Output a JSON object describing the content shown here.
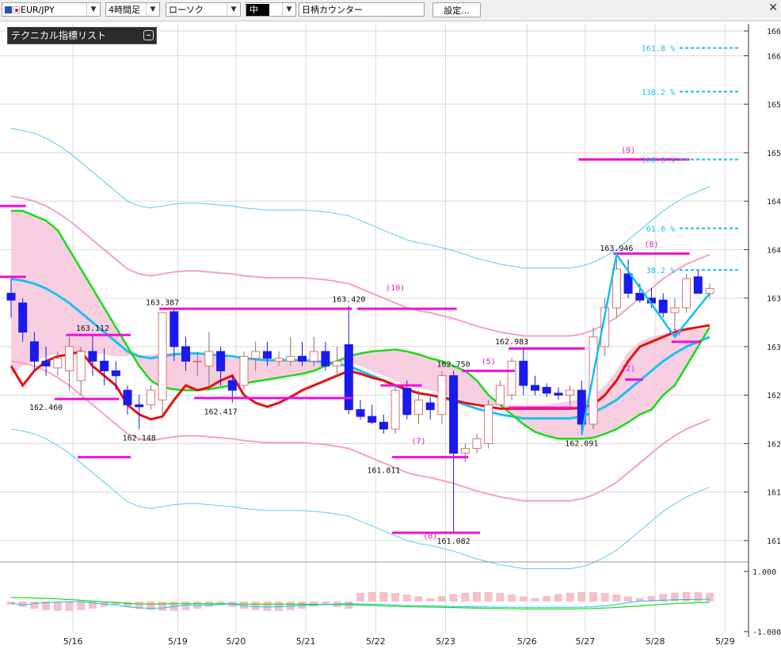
{
  "toolbar": {
    "symbol": "EUR/JPY",
    "timeframe": "4時間足",
    "chart_style": "ローソク",
    "size": "中",
    "counter": "日柄カウンター",
    "settings_label": "設定...",
    "flag_eu_color": "#2a4fb8",
    "flag_jp_color": "#d11a1a"
  },
  "indicator_panel": {
    "title": "テクニカル指標リスト"
  },
  "colors": {
    "bull_candle": "#e07070",
    "bear_candle": "#1a1aee",
    "ma_red": "#e81010",
    "ma_cyan": "#1ec0f0",
    "ma_green": "#18dd18",
    "bb_outer": "#5bcbf0",
    "bb_inner": "#f5a0c8",
    "cloud_pink": "#f7c6dc",
    "cloud_blue": "#c3e0f8",
    "magenta": "#ee10d8",
    "fib_cyan": "#10c0f0",
    "grid": "#d9d9d9"
  },
  "chart_data": {
    "type": "candlestick",
    "symbol": "EUR/JPY",
    "timeframe": "4H",
    "y_range": [
      160.82,
      166.33
    ],
    "y_ticks": [
      "166.256",
      "166.00",
      "165.50",
      "165.00",
      "164.50",
      "164.00",
      "163.50",
      "163.00",
      "162.50",
      "162.00",
      "161.50",
      "161.00"
    ],
    "x_labels": [
      "5/16",
      "5/19",
      "5/20",
      "5/21",
      "5/22",
      "5/23",
      "5/26",
      "5/27",
      "5/28",
      "5/29"
    ],
    "candles": [
      {
        "o": 163.55,
        "h": 163.7,
        "l": 163.3,
        "c": 163.48
      },
      {
        "o": 163.45,
        "h": 163.5,
        "l": 163.05,
        "c": 163.15
      },
      {
        "o": 163.05,
        "h": 163.15,
        "l": 162.75,
        "c": 162.85
      },
      {
        "o": 162.85,
        "h": 163.0,
        "l": 162.7,
        "c": 162.8
      },
      {
        "o": 162.78,
        "h": 162.95,
        "l": 162.7,
        "c": 162.88
      },
      {
        "o": 162.75,
        "h": 163.1,
        "l": 162.55,
        "c": 163.0
      },
      {
        "o": 162.65,
        "h": 163.0,
        "l": 162.5,
        "c": 162.95
      },
      {
        "o": 162.95,
        "h": 163.12,
        "l": 162.7,
        "c": 162.85
      },
      {
        "o": 162.85,
        "h": 162.98,
        "l": 162.6,
        "c": 162.75
      },
      {
        "o": 162.75,
        "h": 162.85,
        "l": 162.55,
        "c": 162.7
      },
      {
        "o": 162.55,
        "h": 162.6,
        "l": 162.3,
        "c": 162.4
      },
      {
        "o": 162.4,
        "h": 162.5,
        "l": 162.15,
        "c": 162.38
      },
      {
        "o": 162.4,
        "h": 162.6,
        "l": 162.35,
        "c": 162.55
      },
      {
        "o": 162.45,
        "h": 163.2,
        "l": 162.3,
        "c": 163.35
      },
      {
        "o": 163.36,
        "h": 163.39,
        "l": 162.85,
        "c": 163.0
      },
      {
        "o": 163.0,
        "h": 163.1,
        "l": 162.75,
        "c": 162.85
      },
      {
        "o": 162.85,
        "h": 162.95,
        "l": 162.7,
        "c": 162.85
      },
      {
        "o": 162.8,
        "h": 163.15,
        "l": 162.6,
        "c": 162.95
      },
      {
        "o": 162.95,
        "h": 163.0,
        "l": 162.6,
        "c": 162.75
      },
      {
        "o": 162.65,
        "h": 162.7,
        "l": 162.42,
        "c": 162.55
      },
      {
        "o": 162.6,
        "h": 162.95,
        "l": 162.55,
        "c": 162.9
      },
      {
        "o": 162.88,
        "h": 163.05,
        "l": 162.75,
        "c": 162.95
      },
      {
        "o": 162.95,
        "h": 163.05,
        "l": 162.8,
        "c": 162.88
      },
      {
        "o": 162.85,
        "h": 162.95,
        "l": 162.8,
        "c": 162.88
      },
      {
        "o": 162.85,
        "h": 163.1,
        "l": 162.8,
        "c": 162.9
      },
      {
        "o": 162.9,
        "h": 163.05,
        "l": 162.8,
        "c": 162.85
      },
      {
        "o": 162.85,
        "h": 163.1,
        "l": 162.8,
        "c": 162.95
      },
      {
        "o": 162.95,
        "h": 163.05,
        "l": 162.75,
        "c": 162.8
      },
      {
        "o": 162.8,
        "h": 163.0,
        "l": 162.7,
        "c": 162.85
      },
      {
        "o": 163.02,
        "h": 163.42,
        "l": 162.3,
        "c": 162.35
      },
      {
        "o": 162.35,
        "h": 162.45,
        "l": 162.25,
        "c": 162.28
      },
      {
        "o": 162.28,
        "h": 162.4,
        "l": 162.2,
        "c": 162.22
      },
      {
        "o": 162.22,
        "h": 162.3,
        "l": 162.1,
        "c": 162.15
      },
      {
        "o": 162.15,
        "h": 162.6,
        "l": 162.1,
        "c": 162.55
      },
      {
        "o": 162.57,
        "h": 162.65,
        "l": 162.25,
        "c": 162.3
      },
      {
        "o": 162.3,
        "h": 162.55,
        "l": 162.2,
        "c": 162.45
      },
      {
        "o": 162.42,
        "h": 162.48,
        "l": 162.25,
        "c": 162.35
      },
      {
        "o": 162.3,
        "h": 162.75,
        "l": 162.2,
        "c": 162.7
      },
      {
        "o": 162.7,
        "h": 162.75,
        "l": 161.08,
        "c": 161.9
      },
      {
        "o": 161.9,
        "h": 162.0,
        "l": 161.81,
        "c": 161.95
      },
      {
        "o": 161.95,
        "h": 162.1,
        "l": 161.9,
        "c": 162.05
      },
      {
        "o": 162.0,
        "h": 162.45,
        "l": 161.95,
        "c": 162.4
      },
      {
        "o": 162.4,
        "h": 162.65,
        "l": 162.38,
        "c": 162.6
      },
      {
        "o": 162.5,
        "h": 162.88,
        "l": 162.45,
        "c": 162.85
      },
      {
        "o": 162.85,
        "h": 162.98,
        "l": 162.5,
        "c": 162.6
      },
      {
        "o": 162.6,
        "h": 162.7,
        "l": 162.5,
        "c": 162.55
      },
      {
        "o": 162.58,
        "h": 162.62,
        "l": 162.48,
        "c": 162.52
      },
      {
        "o": 162.52,
        "h": 162.58,
        "l": 162.45,
        "c": 162.5
      },
      {
        "o": 162.5,
        "h": 162.6,
        "l": 162.4,
        "c": 162.55
      },
      {
        "o": 162.55,
        "h": 162.65,
        "l": 162.09,
        "c": 162.2
      },
      {
        "o": 162.2,
        "h": 163.2,
        "l": 162.15,
        "c": 163.1
      },
      {
        "o": 163.0,
        "h": 163.5,
        "l": 162.9,
        "c": 163.4
      },
      {
        "o": 163.4,
        "h": 163.95,
        "l": 163.3,
        "c": 163.8
      },
      {
        "o": 163.75,
        "h": 163.9,
        "l": 163.5,
        "c": 163.55
      },
      {
        "o": 163.55,
        "h": 163.65,
        "l": 163.45,
        "c": 163.48
      },
      {
        "o": 163.5,
        "h": 163.6,
        "l": 163.4,
        "c": 163.45
      },
      {
        "o": 163.48,
        "h": 163.55,
        "l": 163.3,
        "c": 163.35
      },
      {
        "o": 163.35,
        "h": 163.5,
        "l": 163.15,
        "c": 163.4
      },
      {
        "o": 163.4,
        "h": 163.75,
        "l": 163.35,
        "c": 163.7
      },
      {
        "o": 163.72,
        "h": 163.8,
        "l": 163.55,
        "c": 163.55
      },
      {
        "o": 163.55,
        "h": 163.65,
        "l": 163.5,
        "c": 163.6
      }
    ],
    "series": [
      {
        "name": "",
        "values": [
          162.7,
          162.8,
          162.85,
          162.9,
          162.92,
          162.95,
          162.94,
          162.93,
          162.92,
          162.9,
          162.9,
          162.91,
          162.92,
          162.93,
          162.94,
          162.93,
          162.92,
          162.91,
          162.9,
          162.88,
          162.87,
          162.87,
          162.87,
          162.86,
          162.86,
          162.86,
          162.86,
          162.85,
          162.85,
          162.84,
          162.8,
          162.75,
          162.7,
          162.65,
          162.6,
          162.57,
          162.55,
          162.52,
          162.47,
          162.44,
          162.42,
          162.4,
          162.4,
          162.4,
          162.4,
          162.4,
          162.4,
          162.42,
          162.44,
          162.46,
          162.5,
          162.6,
          162.75,
          162.95,
          163.05,
          163.1,
          163.13,
          163.15,
          163.17,
          163.18,
          163.19
        ]
      },
      {
        "name": "",
        "values": [
          163.7,
          163.68,
          163.65,
          163.6,
          163.53,
          163.45,
          163.35,
          163.25,
          163.15,
          163.05,
          162.95,
          162.9,
          162.88,
          162.9,
          162.92,
          162.93,
          162.93,
          162.92,
          162.91,
          162.9,
          162.88,
          162.87,
          162.86,
          162.86,
          162.86,
          162.86,
          162.85,
          162.84,
          162.82,
          162.8,
          162.75,
          162.7,
          162.65,
          162.6,
          162.55,
          162.52,
          162.5,
          162.47,
          162.44,
          162.4,
          162.36,
          162.33,
          162.3,
          162.28,
          162.26,
          162.26,
          162.26,
          162.26,
          162.26,
          162.28,
          162.32,
          162.38,
          162.45,
          162.55,
          162.65,
          162.75,
          162.85,
          162.93,
          163.0,
          163.05,
          163.1
        ]
      },
      {
        "name": "",
        "values": [
          164.4,
          164.4,
          164.35,
          164.3,
          164.2,
          164.0,
          163.8,
          163.6,
          163.4,
          163.2,
          163.0,
          162.8,
          162.65,
          162.58,
          162.56,
          162.55,
          162.55,
          162.56,
          162.58,
          162.6,
          162.62,
          162.64,
          162.66,
          162.68,
          162.7,
          162.72,
          162.75,
          162.8,
          162.85,
          162.9,
          162.93,
          162.95,
          162.96,
          162.97,
          162.95,
          162.92,
          162.88,
          162.85,
          162.8,
          162.75,
          162.65,
          162.5,
          162.4,
          162.3,
          162.2,
          162.12,
          162.08,
          162.05,
          162.05,
          162.05,
          162.06,
          162.1,
          162.15,
          162.22,
          162.3,
          162.35,
          162.5,
          162.6,
          162.8,
          163.0,
          163.2
        ]
      },
      {
        "name": "",
        "values": [
          162.8,
          162.6,
          162.75,
          162.85,
          162.9,
          162.92,
          162.95,
          162.8,
          162.7,
          162.6,
          162.4,
          162.3,
          162.25,
          162.28,
          162.45,
          162.6,
          162.55,
          162.58,
          162.65,
          162.7,
          162.5,
          162.42,
          162.38,
          162.42,
          162.48,
          162.55,
          162.6,
          162.65,
          162.7,
          162.75,
          162.72,
          162.68,
          162.65,
          162.6,
          162.56,
          162.52,
          162.5,
          162.48,
          162.45,
          162.42,
          162.4,
          162.38,
          162.36,
          162.36,
          162.36,
          162.36,
          162.36,
          162.36,
          162.36,
          162.37,
          162.4,
          162.5,
          162.65,
          162.85,
          163.0,
          163.05,
          163.1,
          163.15,
          163.18,
          163.2,
          163.22
        ]
      }
    ],
    "labels": [
      "163.112",
      "162.460",
      "162.148",
      "163.387",
      "162.417",
      "163.420",
      "162.750",
      "161.811",
      "161.082",
      "162.983",
      "162.091",
      "163.946"
    ],
    "cycle_labels": [
      "(10)",
      "(7)",
      "(8)",
      "(5)",
      "(9)",
      "(8)",
      "(2)",
      "(3)"
    ],
    "fib_levels": [
      {
        "name": "161.8",
        "y": 166.08
      },
      {
        "name": "138.2",
        "y": 165.63
      },
      {
        "name": "100.0",
        "y": 164.93
      },
      {
        "name": "61.8",
        "y": 164.22
      },
      {
        "name": "38.2",
        "y": 163.79
      }
    ],
    "fib_unit": "%",
    "sub_panel": {
      "y_ticks": [
        "1.000",
        "-1.000"
      ]
    },
    "grid": true
  }
}
